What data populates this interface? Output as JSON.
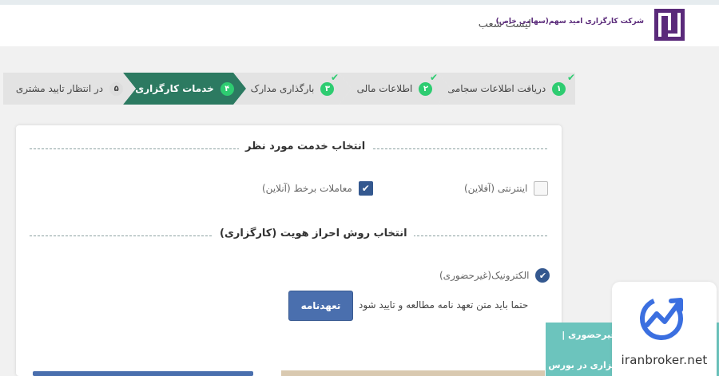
{
  "header": {
    "company_name": "شرکت کارگزاری امید سهم(سهامی خاص)",
    "branches_link": "لیست شعب"
  },
  "steps": [
    {
      "number": "۱",
      "label": "دریافت اطلاعات سجامی",
      "state": "done"
    },
    {
      "number": "۲",
      "label": "اطلاعات مالی",
      "state": "done"
    },
    {
      "number": "۳",
      "label": "بارگذاری مدارک",
      "state": "done"
    },
    {
      "number": "۴",
      "label": "خدمات کارگزاری",
      "state": "active"
    },
    {
      "number": "۵",
      "label": "در انتظار تایید مشتری",
      "state": "pending"
    }
  ],
  "service_section": {
    "title": "انتخاب خدمت مورد نظر",
    "options": [
      {
        "label": "اینترنتی (آفلاین)",
        "checked": false
      },
      {
        "label": "معاملات برخط (آنلاین)",
        "checked": true
      }
    ]
  },
  "identity_section": {
    "title": "انتخاب روش احراز هویت (کارگزاری)",
    "option": {
      "label": "الکترونیک(غیرحضوری)",
      "selected": true
    },
    "note": "حتما باید متن تعهد نامه مطالعه و تایید شود",
    "pledge_button": "تعهدنامه"
  },
  "overlay": {
    "banner_line1": "غیرحضوری |",
    "banner_line2": "گزاری در بورس",
    "watermark": "iranbroker.net"
  },
  "colors": {
    "active_step": "#2c7a61",
    "step_number": "#2ecc71",
    "primary_button": "#4a6fae",
    "checkbox_checked": "#34588f",
    "brand_purple": "#5a2a7a"
  }
}
